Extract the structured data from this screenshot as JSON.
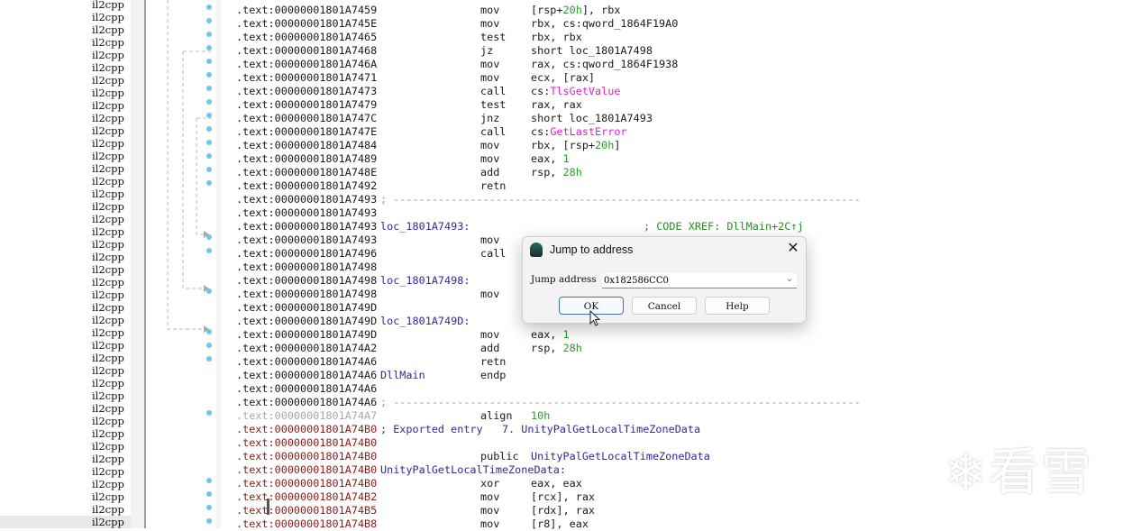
{
  "segments": {
    "name": "il2cpp",
    "count": 42,
    "selected_index": 41
  },
  "disasm": [
    {
      "addr": ".text:00000001801A7459",
      "mnem": "mov",
      "op": [
        [
          "[rsp+",
          ""
        ],
        [
          "20h",
          "num"
        ],
        [
          "], rbx",
          ""
        ]
      ],
      "dot": true
    },
    {
      "addr": ".text:00000001801A745E",
      "mnem": "mov",
      "op": [
        [
          "rbx, cs:qword_1864F19A0",
          ""
        ]
      ],
      "dot": true
    },
    {
      "addr": ".text:00000001801A7465",
      "mnem": "test",
      "op": [
        [
          "rbx, rbx",
          ""
        ]
      ],
      "dot": true
    },
    {
      "addr": ".text:00000001801A7468",
      "mnem": "jz",
      "op": [
        [
          "short loc_1801A7498",
          ""
        ]
      ],
      "dot": true
    },
    {
      "addr": ".text:00000001801A746A",
      "mnem": "mov",
      "op": [
        [
          "rax, cs:qword_1864F1938",
          ""
        ]
      ],
      "dot": true
    },
    {
      "addr": ".text:00000001801A7471",
      "mnem": "mov",
      "op": [
        [
          "ecx, [rax]",
          ""
        ]
      ],
      "dot": true
    },
    {
      "addr": ".text:00000001801A7473",
      "mnem": "call",
      "op": [
        [
          "cs:",
          ""
        ],
        [
          "TlsGetValue",
          "imp"
        ]
      ],
      "dot": true
    },
    {
      "addr": ".text:00000001801A7479",
      "mnem": "test",
      "op": [
        [
          "rax, rax",
          ""
        ]
      ],
      "dot": true
    },
    {
      "addr": ".text:00000001801A747C",
      "mnem": "jnz",
      "op": [
        [
          "short loc_1801A7493",
          ""
        ]
      ],
      "dot": true
    },
    {
      "addr": ".text:00000001801A747E",
      "mnem": "call",
      "op": [
        [
          "cs:",
          ""
        ],
        [
          "GetLastError",
          "imp"
        ]
      ],
      "dot": true
    },
    {
      "addr": ".text:00000001801A7484",
      "mnem": "mov",
      "op": [
        [
          "rbx, [rsp+",
          ""
        ],
        [
          "20h",
          "num"
        ],
        [
          "]",
          ""
        ]
      ],
      "dot": true
    },
    {
      "addr": ".text:00000001801A7489",
      "mnem": "mov",
      "op": [
        [
          "eax, ",
          ""
        ],
        [
          "1",
          "num"
        ]
      ],
      "dot": true
    },
    {
      "addr": ".text:00000001801A748E",
      "mnem": "add",
      "op": [
        [
          "rsp, ",
          ""
        ],
        [
          "28h",
          "num"
        ]
      ],
      "dot": true
    },
    {
      "addr": ".text:00000001801A7492",
      "mnem": "retn",
      "dot": true
    },
    {
      "addr": ".text:00000001801A7493",
      "sep": "; -------------------------------------------------------------------------"
    },
    {
      "addr": ".text:00000001801A7493"
    },
    {
      "addr": ".text:00000001801A7493",
      "label": "loc_1801A7493:",
      "comment": "; CODE XREF: DllMain+2C↑j"
    },
    {
      "addr": ".text:00000001801A7493",
      "mnem": "mov",
      "dot": true
    },
    {
      "addr": ".text:00000001801A7496",
      "mnem": "call",
      "dot": true
    },
    {
      "addr": ".text:00000001801A7498"
    },
    {
      "addr": ".text:00000001801A7498",
      "label": "loc_1801A7498:"
    },
    {
      "addr": ".text:00000001801A7498",
      "mnem": "mov",
      "dot": true
    },
    {
      "addr": ".text:00000001801A749D"
    },
    {
      "addr": ".text:00000001801A749D",
      "label": "loc_1801A749D:"
    },
    {
      "addr": ".text:00000001801A749D",
      "mnem": "mov",
      "op": [
        [
          "eax, ",
          ""
        ],
        [
          "1",
          "num"
        ]
      ],
      "dot": true
    },
    {
      "addr": ".text:00000001801A74A2",
      "mnem": "add",
      "op": [
        [
          "rsp, ",
          ""
        ],
        [
          "28h",
          "num"
        ]
      ],
      "dot": true
    },
    {
      "addr": ".text:00000001801A74A6",
      "mnem": "retn",
      "dot": true
    },
    {
      "addr": ".text:00000001801A74A6",
      "label": "DllMain",
      "mnem": "endp"
    },
    {
      "addr": ".text:00000001801A74A6"
    },
    {
      "addr": ".text:00000001801A74A6",
      "sep": "; -------------------------------------------------------------------------"
    },
    {
      "addr": ".text:00000001801A74A7",
      "addr_style": "gray",
      "mnem": "align",
      "op": [
        [
          "10h",
          "num"
        ]
      ],
      "dot": true
    },
    {
      "addr": ".text:00000001801A74B0",
      "addr_style": "red",
      "label": "; Exported entry   7. UnityPalGetLocalTimeZoneData",
      "label_style": "name"
    },
    {
      "addr": ".text:00000001801A74B0",
      "addr_style": "red"
    },
    {
      "addr": ".text:00000001801A74B0",
      "addr_style": "red",
      "mnem": "public",
      "op": [
        [
          "UnityPalGetLocalTimeZoneData",
          "name"
        ]
      ]
    },
    {
      "addr": ".text:00000001801A74B0",
      "addr_style": "red",
      "label": "UnityPalGetLocalTimeZoneData:"
    },
    {
      "addr": ".text:00000001801A74B0",
      "addr_style": "red",
      "mnem": "xor",
      "op": [
        [
          "eax, eax",
          ""
        ]
      ],
      "dot": true
    },
    {
      "addr": ".text:00000001801A74B2",
      "addr_style": "red",
      "mnem": "mov",
      "op": [
        [
          "[rcx], rax",
          ""
        ]
      ],
      "dot": true
    },
    {
      "addr": ".text:00000001801A74B5",
      "addr_style": "red",
      "mnem": "mov",
      "op": [
        [
          "[rdx], rax",
          ""
        ]
      ],
      "dot": true
    },
    {
      "addr": ".text:00000001801A74B8",
      "addr_style": "red",
      "mnem": "mov",
      "op": [
        [
          "[r8], eax",
          ""
        ]
      ],
      "dot": true
    }
  ],
  "dialog": {
    "title": "Jump to address",
    "label": "Jump address",
    "value": "0x182586CC0",
    "ok": "OK",
    "cancel": "Cancel",
    "help": "Help",
    "close_icon": "✕"
  },
  "watermark": "❄看雪",
  "colors": {
    "dot": "#6cc6ee",
    "import": "#e020d0",
    "number": "#2a9a2a",
    "label": "#2b2b9c",
    "exported_addr": "#8b1a1a"
  }
}
